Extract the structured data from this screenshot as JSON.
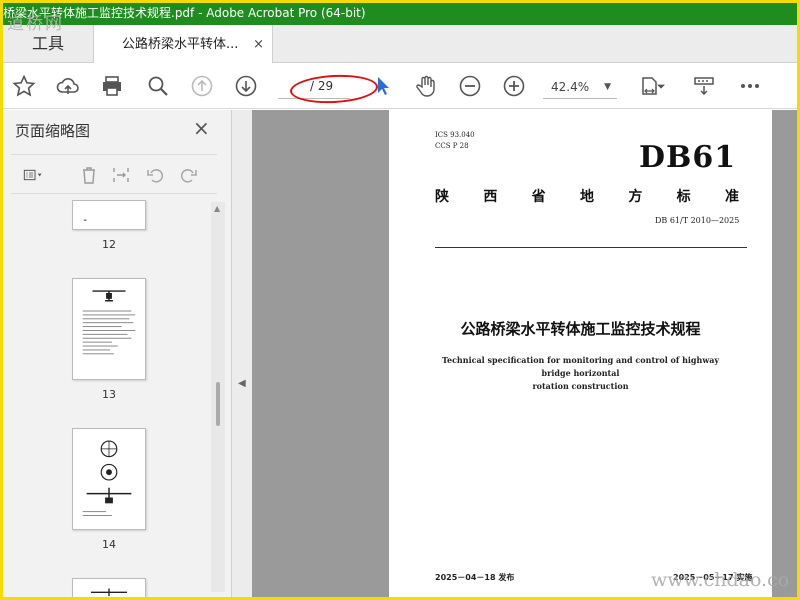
{
  "window": {
    "title": "桥梁水平转体施工监控技术规程.pdf - Adobe Acrobat Pro (64-bit)"
  },
  "watermark": {
    "top_left": "道桥网",
    "bottom_right": "www.chdao.co"
  },
  "tabs": {
    "tools": "工具",
    "doc": "公路桥梁水平转体...",
    "close": "×"
  },
  "toolbar": {
    "page_current": "",
    "page_total": "/ 29",
    "zoom": "42.4%",
    "icons": [
      "star-icon",
      "upload-icon",
      "print-icon",
      "search-icon",
      "page-up-icon",
      "page-down-icon",
      "cursor-icon",
      "hand-icon",
      "zoom-out-icon",
      "zoom-in-icon",
      "fit-page-icon",
      "scroll-mode-icon",
      "more-icon"
    ]
  },
  "sidebar": {
    "title": "页面缩略图",
    "close": "×",
    "thumbnails": [
      {
        "number": "12"
      },
      {
        "number": "13"
      },
      {
        "number": "14"
      }
    ]
  },
  "document": {
    "ics": "ICS  93.040",
    "ccs": "CCS  P  28",
    "code": "DB61",
    "province_chars": [
      "陕",
      "西",
      "省",
      "地",
      "方",
      "标",
      "准"
    ],
    "std_number": "DB 61/T  2010—2025",
    "title_cn": "公路桥梁水平转体施工监控技术规程",
    "title_en_line1": "Technical specification for monitoring and control of highway bridge horizontal",
    "title_en_line2": "rotation construction",
    "published": "2025－04－18 发布",
    "implemented": "2025－05－17 实施"
  },
  "colors": {
    "titlebar": "#1e8c1e",
    "border": "#f5dc00",
    "annotation": "#e01010"
  }
}
